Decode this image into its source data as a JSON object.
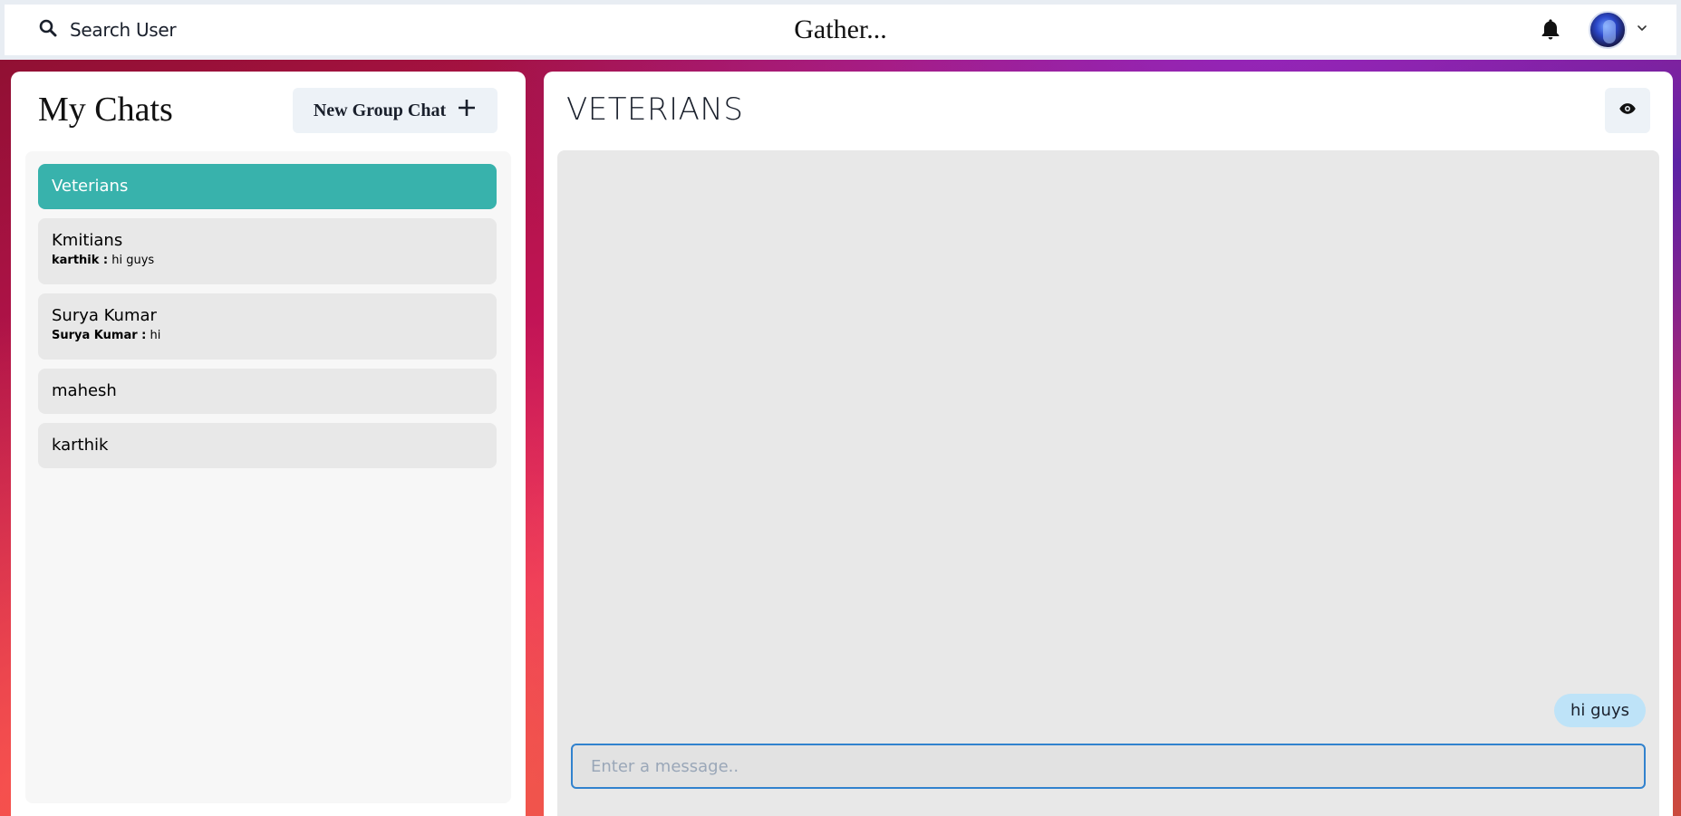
{
  "header": {
    "search_label": "Search User",
    "app_title": "Gather..."
  },
  "sidebar": {
    "title": "My Chats",
    "new_group_label": "New Group Chat",
    "chats": [
      {
        "name": "Veterians",
        "active": true
      },
      {
        "name": "Kmitians",
        "sender": "karthik :",
        "preview": " hi guys"
      },
      {
        "name": "Surya Kumar",
        "sender": "Surya Kumar :",
        "preview": " hi"
      },
      {
        "name": "mahesh"
      },
      {
        "name": "karthik"
      }
    ]
  },
  "chat": {
    "title": "VETERIANS",
    "messages": [
      {
        "text": "hi guys"
      }
    ],
    "input_placeholder": "Enter a message.."
  },
  "colors": {
    "active_chat": "#38b2ac",
    "bubble": "#bee3f8",
    "input_border": "#3182ce"
  },
  "icons": [
    "search-icon",
    "bell-icon",
    "chevron-down-icon",
    "plus-icon",
    "eye-icon"
  ]
}
